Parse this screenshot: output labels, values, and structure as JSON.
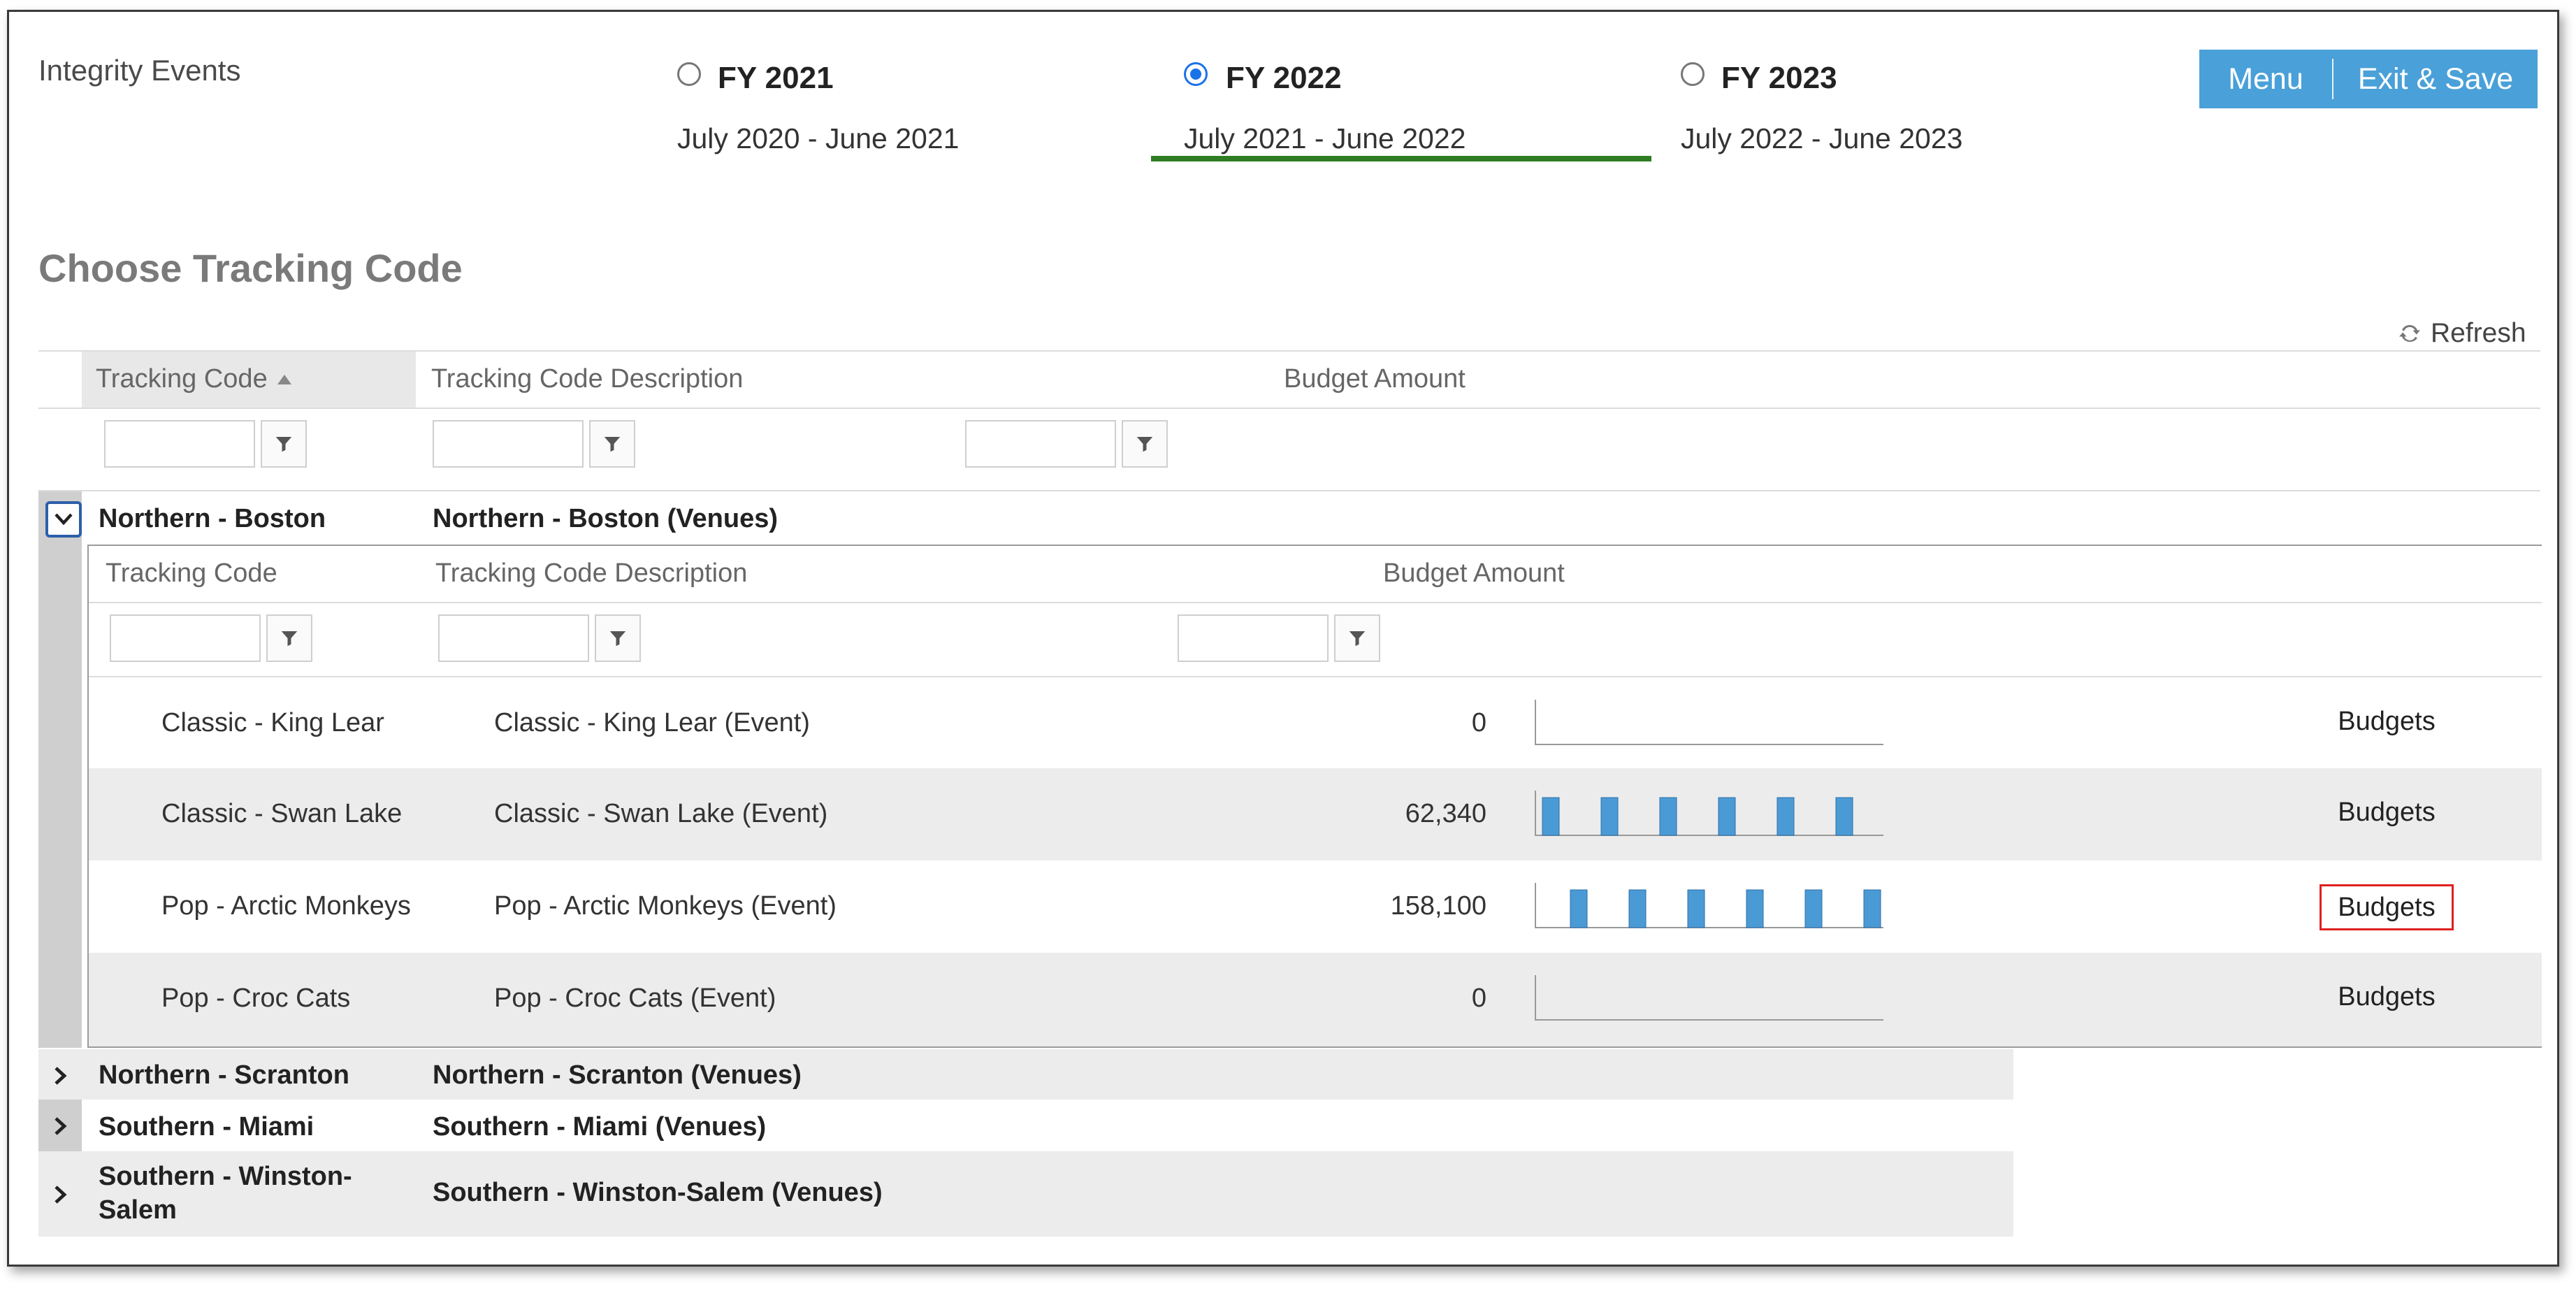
{
  "app": {
    "title": "Integrity Events"
  },
  "fiscal_years": [
    {
      "label": "FY 2021",
      "range": "July 2020 - June 2021",
      "selected": false
    },
    {
      "label": "FY 2022",
      "range": "July 2021 - June 2022",
      "selected": true
    },
    {
      "label": "FY 2023",
      "range": "July 2022 - June 2023",
      "selected": false
    }
  ],
  "header_buttons": {
    "menu": "Menu",
    "exit_save": "Exit & Save"
  },
  "colors": {
    "accent_blue": "#4aa0d8",
    "selected_green": "#2e7d22",
    "highlight_red": "#e02020",
    "bar_blue": "#4a9ad6"
  },
  "section": {
    "title": "Choose Tracking Code",
    "refresh": "Refresh"
  },
  "grid": {
    "columns": {
      "code": "Tracking Code",
      "description": "Tracking Code Description",
      "budget": "Budget Amount"
    },
    "groups": [
      {
        "code": "Northern - Boston",
        "description": "Northern - Boston (Venues)",
        "expanded": true
      },
      {
        "code": "Northern - Scranton",
        "description": "Northern - Scranton (Venues)",
        "expanded": false
      },
      {
        "code": "Southern - Miami",
        "description": "Southern - Miami (Venues)",
        "expanded": false
      },
      {
        "code": "Southern - Winston-Salem",
        "description": "Southern - Winston-Salem (Venues)",
        "expanded": false
      }
    ]
  },
  "detail": {
    "columns": {
      "code": "Tracking Code",
      "description": "Tracking Code Description",
      "budget": "Budget Amount"
    },
    "rows": [
      {
        "code": "Classic - King Lear",
        "description": "Classic - King Lear (Event)",
        "budget": "0",
        "action": "Budgets",
        "bars": []
      },
      {
        "code": "Classic - Swan Lake",
        "description": "Classic - Swan Lake (Event)",
        "budget": "62,340",
        "action": "Budgets",
        "bars": [
          1,
          1,
          1,
          1,
          1,
          1
        ]
      },
      {
        "code": "Pop - Arctic Monkeys",
        "description": "Pop - Arctic Monkeys (Event)",
        "budget": "158,100",
        "action": "Budgets",
        "bars": [
          1,
          1,
          1,
          1,
          1,
          1
        ],
        "highlighted": true
      },
      {
        "code": "Pop - Croc Cats",
        "description": "Pop - Croc Cats (Event)",
        "budget": "0",
        "action": "Budgets",
        "bars": []
      }
    ]
  },
  "icons": {
    "filter": "filter-icon",
    "refresh": "refresh-icon",
    "expand": "chevron-down-icon",
    "collapsed": "chevron-right-icon",
    "sort": "sort-asc-icon"
  }
}
